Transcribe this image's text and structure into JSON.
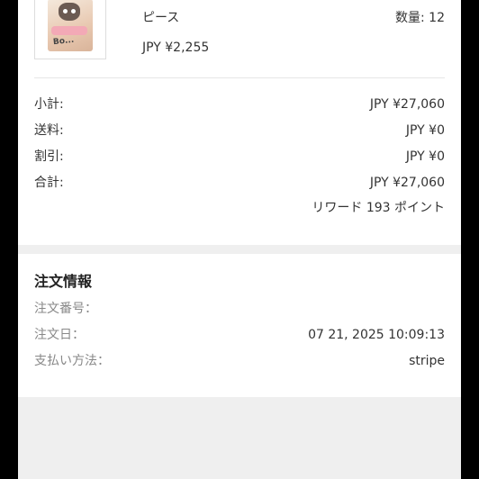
{
  "product": {
    "variant": "ピース",
    "qty_label": "数量: 12",
    "price": "JPY ¥2,255",
    "thumbnail_text": "Bo..."
  },
  "summary": {
    "subtotal_label": "小計:",
    "subtotal_value": "JPY ¥27,060",
    "shipping_label": "送料:",
    "shipping_value": "JPY ¥0",
    "discount_label": "割引:",
    "discount_value": "JPY ¥0",
    "total_label": "合計:",
    "total_value": "JPY ¥27,060",
    "reward_text": "リワード 193 ポイント"
  },
  "order_info": {
    "title": "注文情報",
    "number_label": "注文番号：",
    "date_label": "注文日：",
    "date_value": "07 21, 2025 10:09:13",
    "payment_label": "支払い方法：",
    "payment_value": "stripe"
  }
}
